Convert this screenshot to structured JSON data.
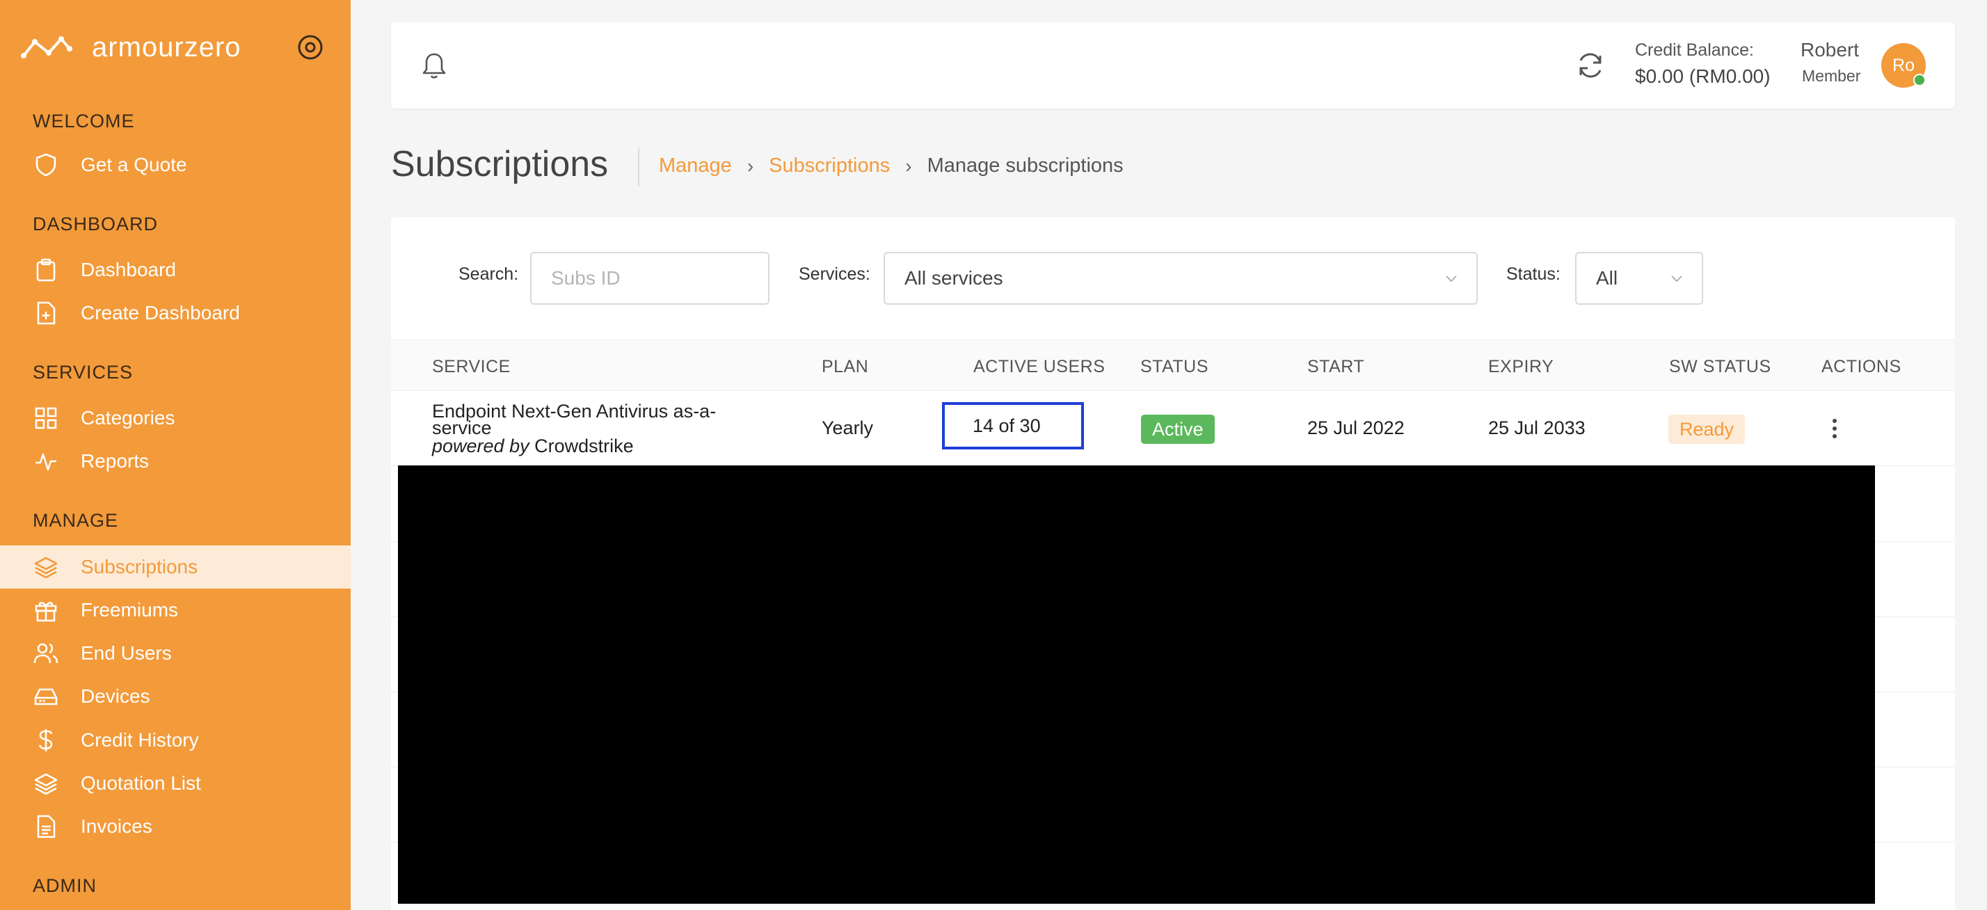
{
  "brand": {
    "name": "armourzero"
  },
  "sidebar": {
    "sections": [
      {
        "title": "WELCOME"
      },
      {
        "title": "DASHBOARD"
      },
      {
        "title": "SERVICES"
      },
      {
        "title": "MANAGE"
      },
      {
        "title": "ADMIN"
      }
    ],
    "items": [
      {
        "label": "Get a Quote",
        "icon": "shield-icon"
      },
      {
        "label": "Dashboard",
        "icon": "clipboard-icon"
      },
      {
        "label": "Create Dashboard",
        "icon": "file-plus-icon"
      },
      {
        "label": "Categories",
        "icon": "grid-icon"
      },
      {
        "label": "Reports",
        "icon": "activity-icon"
      },
      {
        "label": "Subscriptions",
        "icon": "layers-icon",
        "active": true
      },
      {
        "label": "Freemiums",
        "icon": "gift-icon"
      },
      {
        "label": "End Users",
        "icon": "users-icon"
      },
      {
        "label": "Devices",
        "icon": "hard-drive-icon"
      },
      {
        "label": "Credit History",
        "icon": "dollar-icon"
      },
      {
        "label": "Quotation List",
        "icon": "layers-icon"
      },
      {
        "label": "Invoices",
        "icon": "document-icon"
      }
    ]
  },
  "header": {
    "credit_label": "Credit Balance:",
    "credit_value": "$0.00 (RM0.00)",
    "user_name": "Robert",
    "user_role": "Member",
    "avatar_initials": "Ro"
  },
  "page": {
    "title": "Subscriptions",
    "breadcrumb": [
      "Manage",
      "Subscriptions",
      "Manage subscriptions"
    ]
  },
  "filters": {
    "search_label": "Search:",
    "search_placeholder": "Subs ID",
    "services_label": "Services:",
    "services_value": "All services",
    "status_label": "Status:",
    "status_value": "All"
  },
  "table": {
    "columns": [
      "SERVICE",
      "PLAN",
      "ACTIVE USERS",
      "STATUS",
      "START",
      "EXPIRY",
      "SW STATUS",
      "ACTIONS"
    ],
    "rows": [
      {
        "service_line1": "Endpoint Next-Gen Antivirus as-a-",
        "service_line2": "service",
        "powered_prefix": "powered by",
        "powered_vendor": "Crowdstrike",
        "plan": "Yearly",
        "active_users": "14 of 30",
        "status": "Active",
        "start": "25 Jul 2022",
        "expiry": "25 Jul 2033",
        "sw_status": "Ready"
      }
    ]
  },
  "colors": {
    "accent": "#f39a3a",
    "active_badge": "#5cb85c",
    "highlight_border": "#1f3fd6"
  }
}
